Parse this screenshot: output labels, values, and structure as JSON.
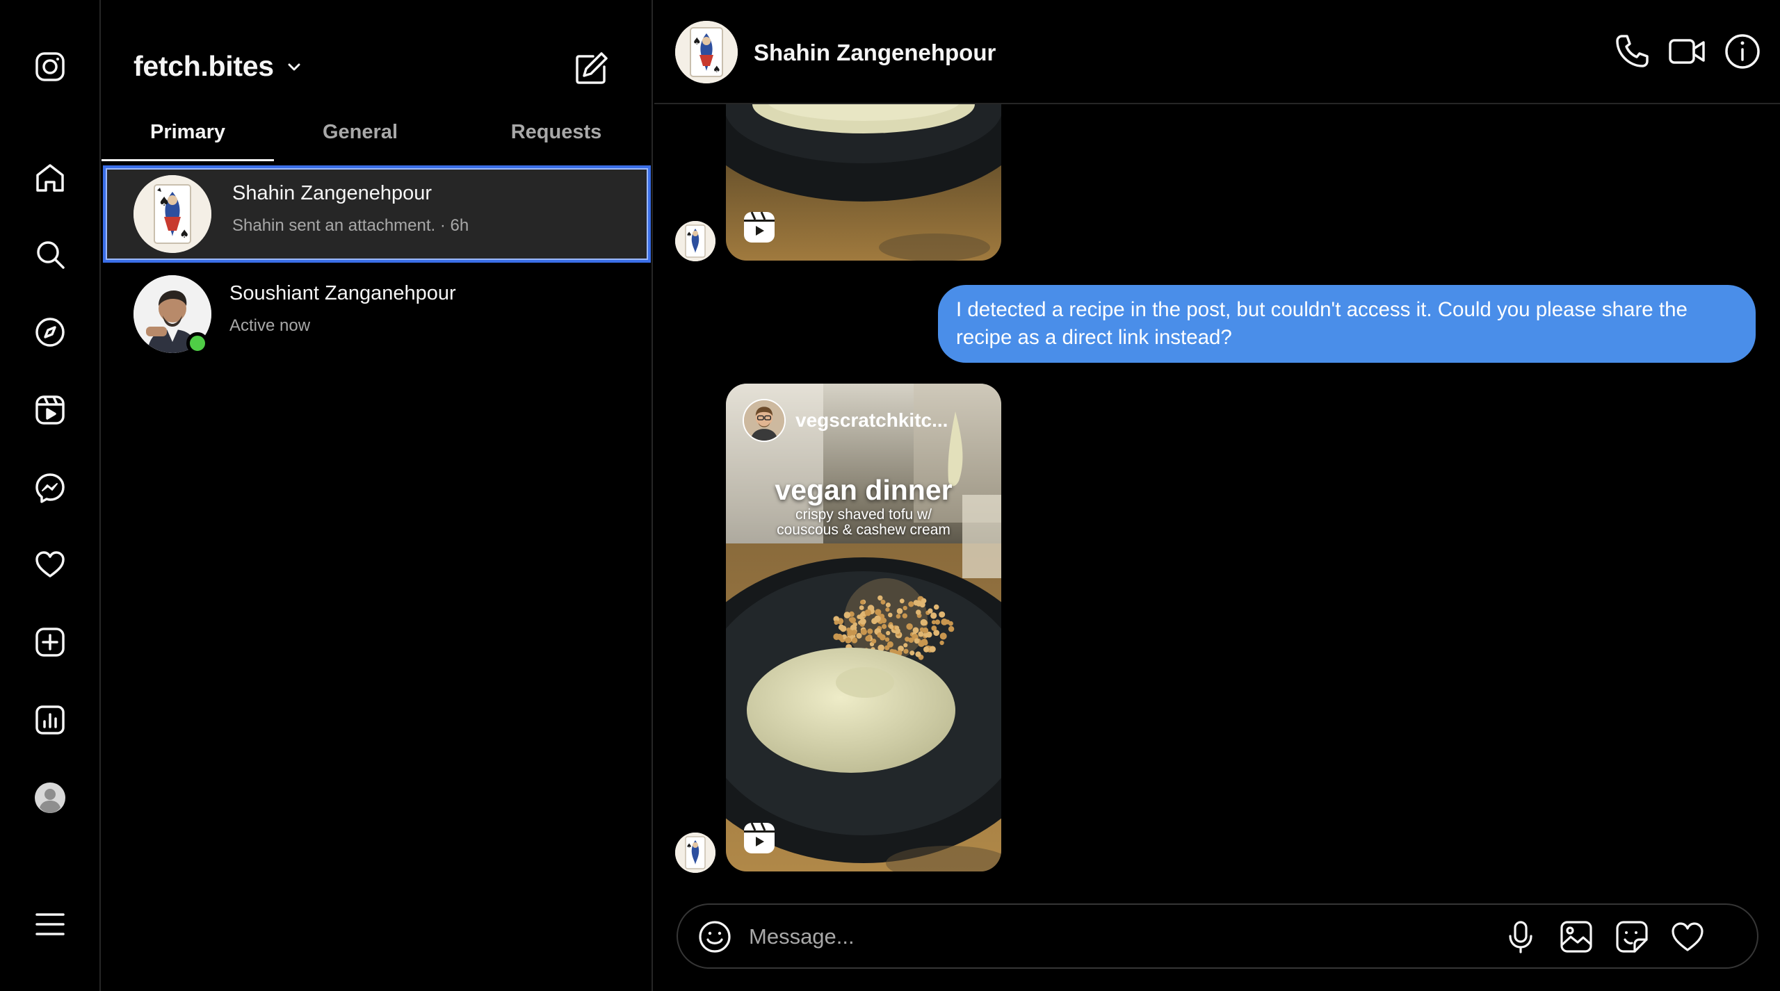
{
  "account": {
    "name": "fetch.bites"
  },
  "tabs": [
    {
      "label": "Primary",
      "active": true
    },
    {
      "label": "General",
      "active": false
    },
    {
      "label": "Requests",
      "active": false
    }
  ],
  "threads": [
    {
      "name": "Shahin Zangenehpour",
      "preview": "Shahin sent an attachment.",
      "time": "6h",
      "separator": "·",
      "selected": true
    },
    {
      "name": "Soushiant Zanganehpour",
      "preview": "Active now",
      "online": true
    }
  ],
  "chat": {
    "contact_name": "Shahin Zangenehpour",
    "messages": [
      {
        "type": "reel",
        "from": "contact"
      },
      {
        "type": "text",
        "from": "me",
        "text": "I detected a recipe in the post, but couldn't access it. Could you please share the recipe as a direct link instead?"
      },
      {
        "type": "reel",
        "from": "contact",
        "author": "vegscratchkitc...",
        "title": "vegan dinner",
        "subtitle_line1": "crispy shaved tofu w/",
        "subtitle_line2": "couscous & cashew cream"
      }
    ],
    "composer_placeholder": "Message..."
  },
  "colors": {
    "accent": "#4a8ee9",
    "selection_outline": "#3b6fe8",
    "online": "#4fcd46",
    "divider": "#262626"
  },
  "icons": {
    "rail": [
      "instagram-logo-icon",
      "home-icon",
      "search-icon",
      "explore-icon",
      "reels-icon",
      "messenger-icon",
      "heart-icon",
      "create-icon",
      "insights-icon",
      "profile-icon",
      "menu-icon"
    ],
    "header": [
      "phone-icon",
      "video-call-icon",
      "info-icon"
    ],
    "composer": [
      "emoji-icon",
      "microphone-icon",
      "image-icon",
      "sticker-icon",
      "heart-icon"
    ]
  }
}
